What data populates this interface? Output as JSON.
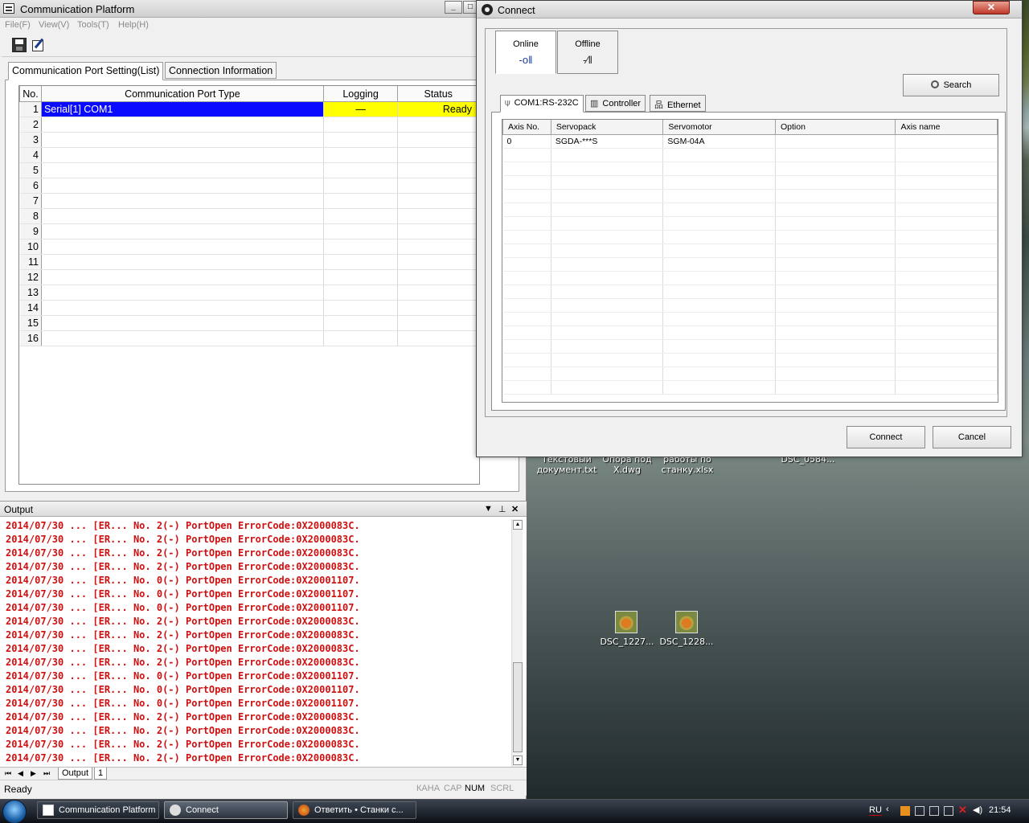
{
  "main_window": {
    "title": "Communication Platform",
    "menu": [
      "File(F)",
      "View(V)",
      "Tools(T)",
      "Help(H)"
    ],
    "tabs": [
      "Communication Port Setting(List)",
      "Connection Information"
    ],
    "table": {
      "headers": [
        "No.",
        "Communication Port Type",
        "Logging",
        "Status"
      ],
      "rows": [
        {
          "no": "1",
          "type": "Serial[1] COM1",
          "logging": "—",
          "status": "Ready"
        },
        {
          "no": "2",
          "type": "",
          "logging": "",
          "status": ""
        },
        {
          "no": "3",
          "type": "",
          "logging": "",
          "status": ""
        },
        {
          "no": "4",
          "type": "",
          "logging": "",
          "status": ""
        },
        {
          "no": "5",
          "type": "",
          "logging": "",
          "status": ""
        },
        {
          "no": "6",
          "type": "",
          "logging": "",
          "status": ""
        },
        {
          "no": "7",
          "type": "",
          "logging": "",
          "status": ""
        },
        {
          "no": "8",
          "type": "",
          "logging": "",
          "status": ""
        },
        {
          "no": "9",
          "type": "",
          "logging": "",
          "status": ""
        },
        {
          "no": "10",
          "type": "",
          "logging": "",
          "status": ""
        },
        {
          "no": "11",
          "type": "",
          "logging": "",
          "status": ""
        },
        {
          "no": "12",
          "type": "",
          "logging": "",
          "status": ""
        },
        {
          "no": "13",
          "type": "",
          "logging": "",
          "status": ""
        },
        {
          "no": "14",
          "type": "",
          "logging": "",
          "status": ""
        },
        {
          "no": "15",
          "type": "",
          "logging": "",
          "status": ""
        },
        {
          "no": "16",
          "type": "",
          "logging": "",
          "status": ""
        }
      ]
    },
    "output": {
      "title": "Output",
      "lines": [
        "2014/07/30 ... [ER... No. 2(-) PortOpen ErrorCode:0X2000083C.",
        "2014/07/30 ... [ER... No. 2(-) PortOpen ErrorCode:0X2000083C.",
        "2014/07/30 ... [ER... No. 2(-) PortOpen ErrorCode:0X2000083C.",
        "2014/07/30 ... [ER... No. 2(-) PortOpen ErrorCode:0X2000083C.",
        "2014/07/30 ... [ER... No. 0(-) PortOpen ErrorCode:0X20001107.",
        "2014/07/30 ... [ER... No. 0(-) PortOpen ErrorCode:0X20001107.",
        "2014/07/30 ... [ER... No. 0(-) PortOpen ErrorCode:0X20001107.",
        "2014/07/30 ... [ER... No. 2(-) PortOpen ErrorCode:0X2000083C.",
        "2014/07/30 ... [ER... No. 2(-) PortOpen ErrorCode:0X2000083C.",
        "2014/07/30 ... [ER... No. 2(-) PortOpen ErrorCode:0X2000083C.",
        "2014/07/30 ... [ER... No. 2(-) PortOpen ErrorCode:0X2000083C.",
        "2014/07/30 ... [ER... No. 0(-) PortOpen ErrorCode:0X20001107.",
        "2014/07/30 ... [ER... No. 0(-) PortOpen ErrorCode:0X20001107.",
        "2014/07/30 ... [ER... No. 0(-) PortOpen ErrorCode:0X20001107.",
        "2014/07/30 ... [ER... No. 2(-) PortOpen ErrorCode:0X2000083C.",
        "2014/07/30 ... [ER... No. 2(-) PortOpen ErrorCode:0X2000083C.",
        "2014/07/30 ... [ER... No. 2(-) PortOpen ErrorCode:0X2000083C.",
        "2014/07/30 ... [ER... No. 2(-) PortOpen ErrorCode:0X2000083C."
      ],
      "bottom_tabs": [
        "Output",
        "1"
      ]
    },
    "status": {
      "text": "Ready",
      "indicators": [
        "КАНА",
        "CAP",
        "NUM",
        "SCRL"
      ]
    }
  },
  "connect_dialog": {
    "title": "Connect",
    "close_glyph": "✕",
    "modes": [
      "Online",
      "Offline"
    ],
    "search_label": "Search",
    "port_tabs": [
      "COM1:RS-232C",
      "Controller",
      "Ethernet"
    ],
    "axis_table": {
      "headers": [
        "Axis No.",
        "Servopack",
        "Servomotor",
        "Option",
        "Axis name"
      ],
      "rows": [
        {
          "axis": "0",
          "servopack": "SGDA-***S",
          "servomotor": "SGM-04A",
          "option": "",
          "axis_name": ""
        }
      ]
    },
    "buttons": {
      "connect": "Connect",
      "cancel": "Cancel"
    }
  },
  "desktop": {
    "labels": [
      {
        "text": "Текстовый\nдокумент.txt"
      },
      {
        "text": "Опора под\nX.dwg"
      },
      {
        "text": "работы по\nстанку.xlsx"
      },
      {
        "text": "DSC_0584..."
      },
      {
        "text": "DSC_1227..."
      },
      {
        "text": "DSC_1228..."
      }
    ]
  },
  "taskbar": {
    "items": [
      "Communication Platform",
      "Connect",
      "Ответить • Станки с..."
    ],
    "language": "RU",
    "time": "21:54"
  },
  "colors": {
    "selection_blue": "#0a0aff",
    "ready_yellow": "#ffff00",
    "log_red": "#d01010"
  }
}
